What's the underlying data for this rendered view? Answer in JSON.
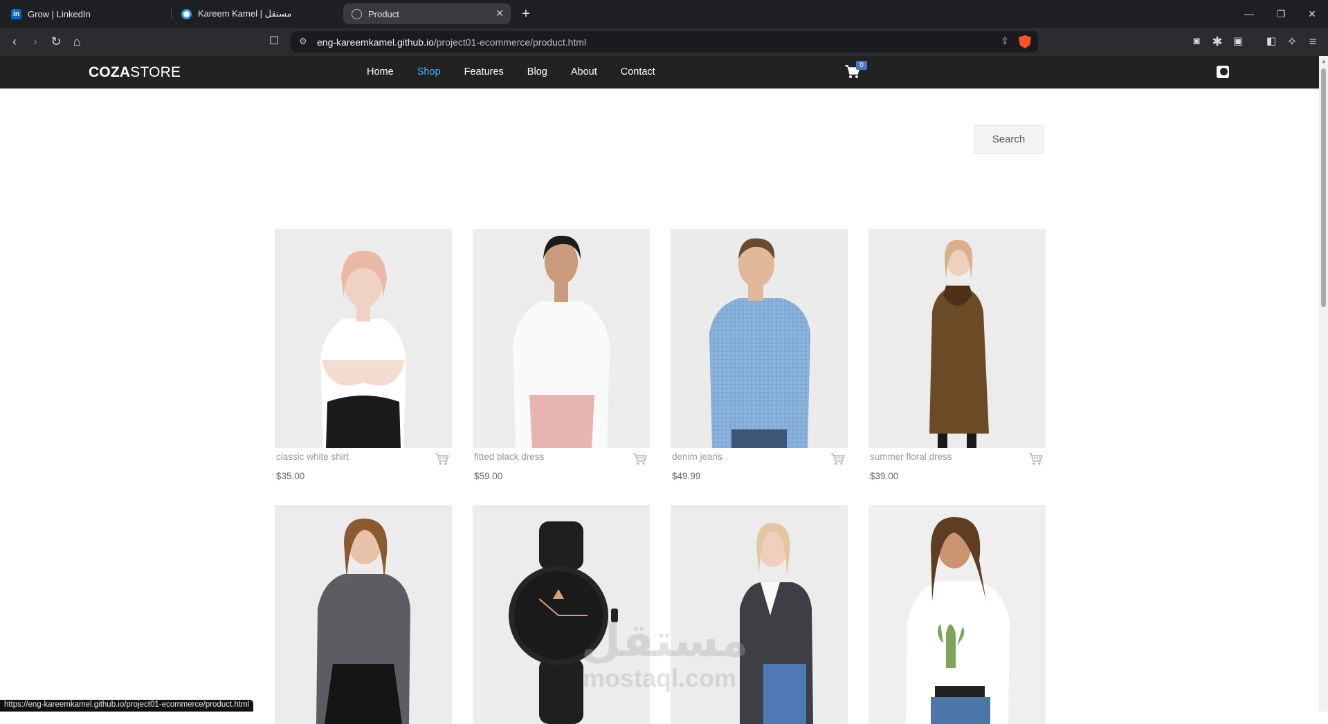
{
  "browser": {
    "tabs": [
      {
        "label": "Grow | LinkedIn",
        "favicon": "linkedin-icon"
      },
      {
        "label": "Kareem Kamel | مستقل",
        "favicon": "mostaql-icon"
      },
      {
        "label": "Product",
        "favicon": "globe-icon",
        "active": true
      }
    ],
    "url_host": "eng-kareemkamel.github.io",
    "url_path": "/project01-ecommerce/product.html",
    "status_url": "https://eng-kareemkamel.github.io/project01-ecommerce/product.html"
  },
  "site": {
    "logo_bold": "COZA",
    "logo_light": "STORE",
    "nav": [
      "Home",
      "Shop",
      "Features",
      "Blog",
      "About",
      "Contact"
    ],
    "active_nav": "Shop",
    "cart_count": "0",
    "search_label": "Search"
  },
  "products": [
    {
      "title": "classic white shirt",
      "price": "$35.00",
      "image": "woman-white-tshirt"
    },
    {
      "title": "fitted black dress",
      "price": "$59.00",
      "image": "woman-white-blouse-pink-pants"
    },
    {
      "title": "denim jeans",
      "price": "$49.99",
      "image": "man-blue-checked-shirt"
    },
    {
      "title": "summer floral dress",
      "price": "$39.00",
      "image": "woman-brown-coat"
    },
    {
      "title": "",
      "price": "",
      "image": "woman-gray-shirt-black-skirt"
    },
    {
      "title": "",
      "price": "",
      "image": "black-wrist-watch"
    },
    {
      "title": "",
      "price": "",
      "image": "woman-plaid-blazer-jeans"
    },
    {
      "title": "",
      "price": "",
      "image": "woman-cactus-tshirt"
    }
  ],
  "watermark": {
    "line1": "مستقل",
    "line2": "mostaql.com"
  },
  "colors": {
    "accent": "#3bb3ff",
    "header_bg": "#222222",
    "badge": "#4b76bf"
  }
}
